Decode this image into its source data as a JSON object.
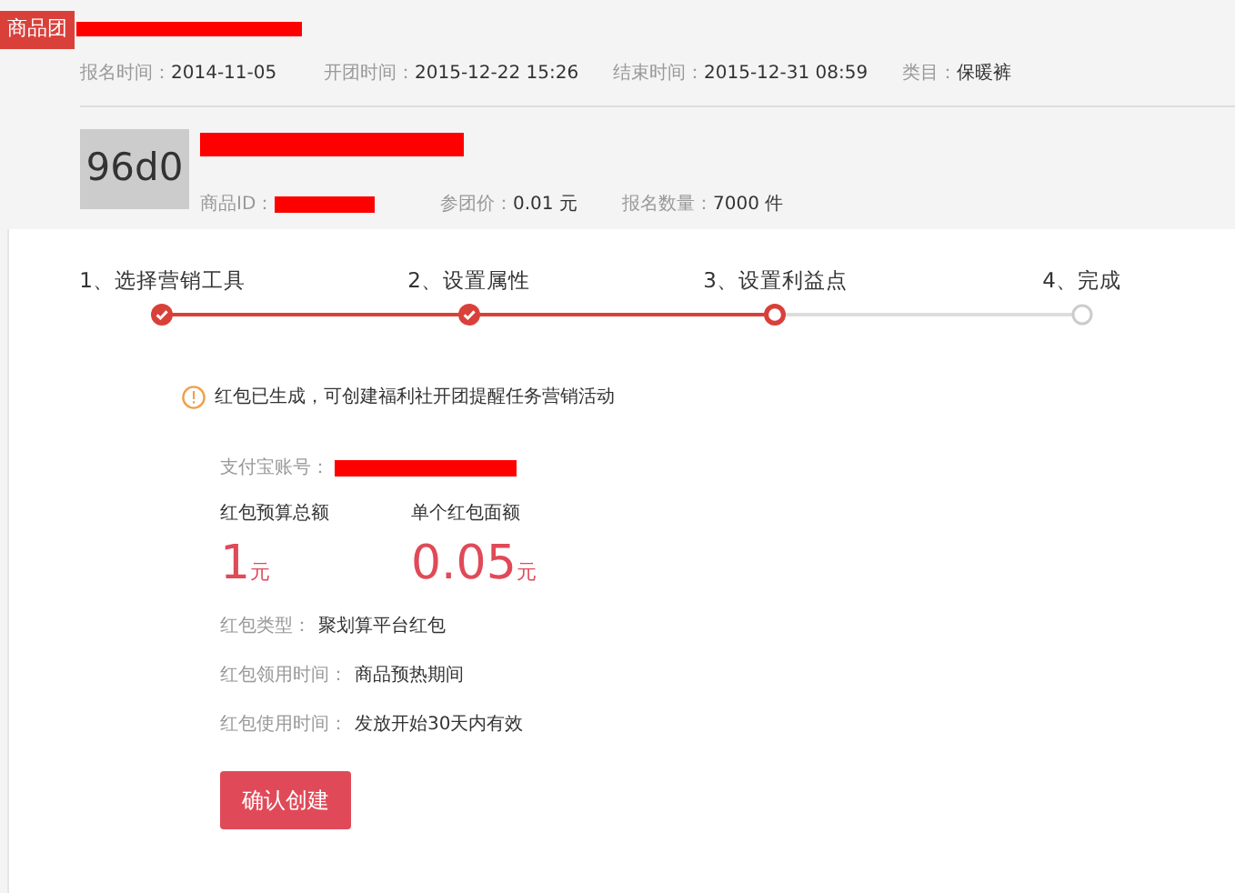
{
  "badge": "商品团",
  "meta": [
    {
      "label": "报名时间：",
      "value": "2014-11-05"
    },
    {
      "label": "开团时间：",
      "value": "2015-12-22 15:26"
    },
    {
      "label": "结束时间：",
      "value": "2015-12-31 08:59"
    },
    {
      "label": "类目：",
      "value": "保暖裤"
    }
  ],
  "thumbnail": "96d0",
  "item_meta": [
    {
      "label": "商品ID：",
      "kind": "redacted"
    },
    {
      "label": "参团价：",
      "value": "0.01 元"
    },
    {
      "label": "报名数量：",
      "value": "7000 件"
    }
  ],
  "steps": [
    {
      "label": "1、选择营销工具",
      "completed": true,
      "selected": false
    },
    {
      "label": "2、设置属性",
      "completed": true,
      "selected": false
    },
    {
      "label": "3、设置利益点",
      "completed": false,
      "selected": true
    },
    {
      "label": "4、完成",
      "completed": false,
      "selected": false
    }
  ],
  "notice": "红包已生成，可创建福利社开团提醒任务营销活动",
  "alipay_label": "支付宝账号：",
  "amounts": [
    {
      "label": "红包预算总额",
      "value": "1",
      "unit": "元"
    },
    {
      "label": "单个红包面额",
      "value": "0.05",
      "unit": "元"
    }
  ],
  "details": [
    {
      "label": "红包类型：",
      "value": "聚划算平台红包"
    },
    {
      "label": "红包领用时间：",
      "value": "商品预热期间"
    },
    {
      "label": "红包使用时间：",
      "value": "发放开始30天内有效"
    }
  ],
  "button": "确认创建"
}
